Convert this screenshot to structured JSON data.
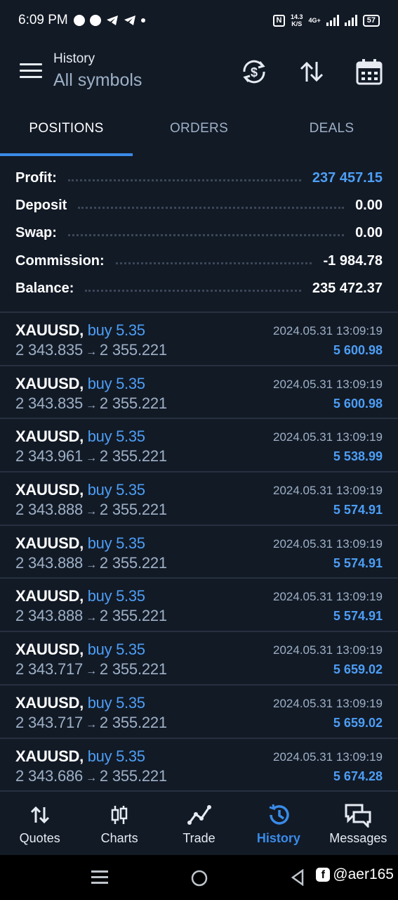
{
  "status_bar": {
    "time": "6:09 PM",
    "net_speed": "14.3",
    "net_unit": "K/S",
    "network_type": "4G+",
    "battery": "57"
  },
  "header": {
    "title": "History",
    "subtitle": "All symbols"
  },
  "tabs": [
    {
      "label": "POSITIONS",
      "active": true
    },
    {
      "label": "ORDERS",
      "active": false
    },
    {
      "label": "DEALS",
      "active": false
    }
  ],
  "summary": {
    "profit_label": "Profit:",
    "profit_value": "237 457.15",
    "deposit_label": "Deposit",
    "deposit_value": "0.00",
    "swap_label": "Swap:",
    "swap_value": "0.00",
    "commission_label": "Commission:",
    "commission_value": "-1 984.78",
    "balance_label": "Balance:",
    "balance_value": "235 472.37"
  },
  "positions": [
    {
      "symbol": "XAUUSD,",
      "side": "buy 5.35",
      "open": "2 343.835",
      "close": "2 355.221",
      "time": "2024.05.31 13:09:19",
      "profit": "5 600.98"
    },
    {
      "symbol": "XAUUSD,",
      "side": "buy 5.35",
      "open": "2 343.835",
      "close": "2 355.221",
      "time": "2024.05.31 13:09:19",
      "profit": "5 600.98"
    },
    {
      "symbol": "XAUUSD,",
      "side": "buy 5.35",
      "open": "2 343.961",
      "close": "2 355.221",
      "time": "2024.05.31 13:09:19",
      "profit": "5 538.99"
    },
    {
      "symbol": "XAUUSD,",
      "side": "buy 5.35",
      "open": "2 343.888",
      "close": "2 355.221",
      "time": "2024.05.31 13:09:19",
      "profit": "5 574.91"
    },
    {
      "symbol": "XAUUSD,",
      "side": "buy 5.35",
      "open": "2 343.888",
      "close": "2 355.221",
      "time": "2024.05.31 13:09:19",
      "profit": "5 574.91"
    },
    {
      "symbol": "XAUUSD,",
      "side": "buy 5.35",
      "open": "2 343.888",
      "close": "2 355.221",
      "time": "2024.05.31 13:09:19",
      "profit": "5 574.91"
    },
    {
      "symbol": "XAUUSD,",
      "side": "buy 5.35",
      "open": "2 343.717",
      "close": "2 355.221",
      "time": "2024.05.31 13:09:19",
      "profit": "5 659.02"
    },
    {
      "symbol": "XAUUSD,",
      "side": "buy 5.35",
      "open": "2 343.717",
      "close": "2 355.221",
      "time": "2024.05.31 13:09:19",
      "profit": "5 659.02"
    },
    {
      "symbol": "XAUUSD,",
      "side": "buy 5.35",
      "open": "2 343.686",
      "close": "2 355.221",
      "time": "2024.05.31 13:09:19",
      "profit": "5 674.28"
    }
  ],
  "arrow_glyph": "→",
  "bottom_nav": [
    {
      "label": "Quotes",
      "icon": "quotes-icon",
      "active": false
    },
    {
      "label": "Charts",
      "icon": "charts-icon",
      "active": false
    },
    {
      "label": "Trade",
      "icon": "trade-icon",
      "active": false
    },
    {
      "label": "History",
      "icon": "history-icon",
      "active": true
    },
    {
      "label": "Messages",
      "icon": "messages-icon",
      "active": false
    }
  ],
  "watermark": "@aer165",
  "colors": {
    "background": "#121a26",
    "accent": "#3a8be8",
    "profit": "#4d9ef5",
    "muted": "#9eb0c6"
  }
}
